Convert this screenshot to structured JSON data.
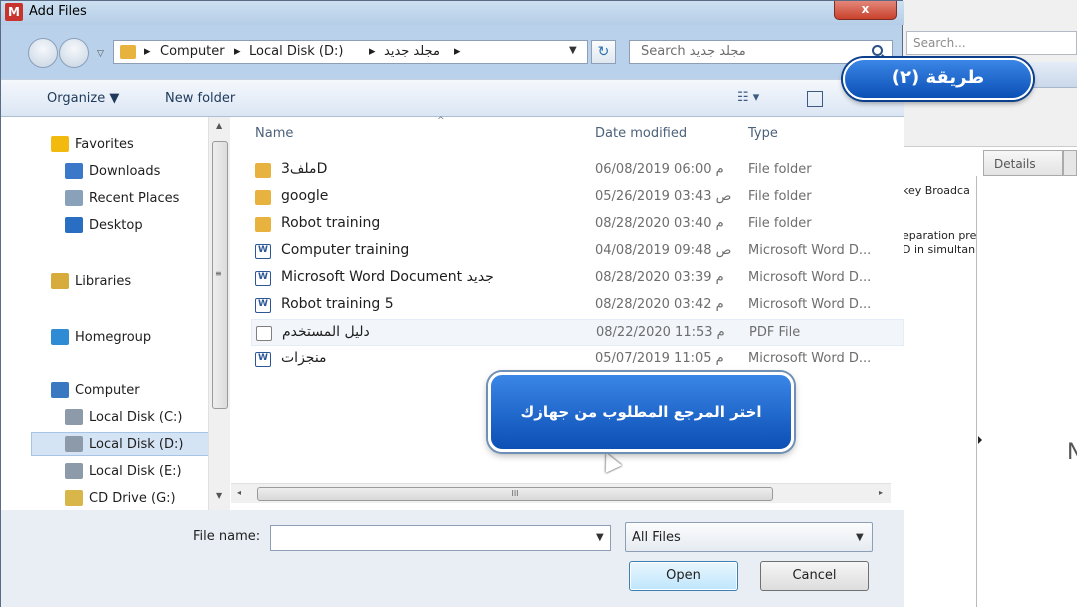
{
  "window": {
    "title": "Add Files",
    "app_icon_glyph": "M",
    "close_glyph": "x"
  },
  "address": {
    "crumbs": [
      "Computer",
      "Local Disk (D:)",
      "مجلد جديد"
    ],
    "search_placeholder": "Search مجلد جديد"
  },
  "toolbar": {
    "organize": "Organize ▼",
    "new_folder": "New folder",
    "view_glyph": "☷ ▾"
  },
  "nav": {
    "items": [
      {
        "label": "Favorites",
        "icon": "star-icon",
        "color": "#f2b90f"
      },
      {
        "label": "Downloads",
        "icon": "downloads-folder-icon",
        "color": "#3b78c9"
      },
      {
        "label": "Recent Places",
        "icon": "recent-places-icon",
        "color": "#8aa2b9"
      },
      {
        "label": "Desktop",
        "icon": "desktop-icon",
        "color": "#2a6ec4"
      },
      {
        "label": "Libraries",
        "icon": "libraries-icon",
        "color": "#d7ab3c"
      },
      {
        "label": "Homegroup",
        "icon": "homegroup-icon",
        "color": "#2e8bd4"
      },
      {
        "label": "Computer",
        "icon": "computer-icon",
        "color": "#3a78c1"
      },
      {
        "label": "Local Disk (C:)",
        "icon": "drive-c-icon",
        "color": "#8c9aa9"
      },
      {
        "label": "Local Disk (D:)",
        "icon": "drive-d-icon",
        "color": "#8c9aa9"
      },
      {
        "label": "Local Disk (E:)",
        "icon": "drive-e-icon",
        "color": "#8c9aa9"
      },
      {
        "label": "CD Drive (G:)",
        "icon": "cd-drive-icon",
        "color": "#d9b64a"
      }
    ],
    "selected": "Local Disk (D:)"
  },
  "columns": {
    "name": "Name",
    "date": "Date modified",
    "type": "Type"
  },
  "files": [
    {
      "name": "ملف3D",
      "date": "06/08/2019 06:00 م",
      "type": "File folder",
      "icon": "folder-icon"
    },
    {
      "name": "google",
      "date": "05/26/2019 03:43 ص",
      "type": "File folder",
      "icon": "folder-icon"
    },
    {
      "name": "Robot training",
      "date": "08/28/2020 03:40 م",
      "type": "File folder",
      "icon": "folder-icon"
    },
    {
      "name": "Computer training",
      "date": "04/08/2019 09:48 ص",
      "type": "Microsoft Word D...",
      "icon": "word-doc-icon"
    },
    {
      "name": "Microsoft Word Document جديد",
      "date": "08/28/2020 03:39 م",
      "type": "Microsoft Word D...",
      "icon": "word-doc-icon"
    },
    {
      "name": "Robot training 5",
      "date": "08/28/2020 03:42 م",
      "type": "Microsoft Word D...",
      "icon": "word-doc-icon"
    },
    {
      "name": "دليل المستخدم",
      "date": "08/22/2020 11:53 م",
      "type": "PDF File",
      "icon": "pdf-file-icon"
    },
    {
      "name": "منجزات",
      "date": "05/07/2019 11:05 م",
      "type": "Microsoft Word D...",
      "icon": "word-doc-icon"
    }
  ],
  "hscroll_grip": "III",
  "bottom": {
    "file_name_label": "File name:",
    "file_name_value": "",
    "file_type": "All Files",
    "open": "Open",
    "cancel": "Cancel"
  },
  "overlay": {
    "method_badge": "طريقة (٢)",
    "callout": "اختر المرجع المطلوب من جهازك"
  },
  "background_app": {
    "search_placeholder": "Search...",
    "details_tab": "Details",
    "snippets": [
      "key Broadca",
      "eparation pre",
      "D in simultan"
    ],
    "edge_letter": "N"
  },
  "colors": {
    "accent_blue": "#0c4fb5",
    "folder": "#e8b23e",
    "selection": "#d5e4f5"
  }
}
